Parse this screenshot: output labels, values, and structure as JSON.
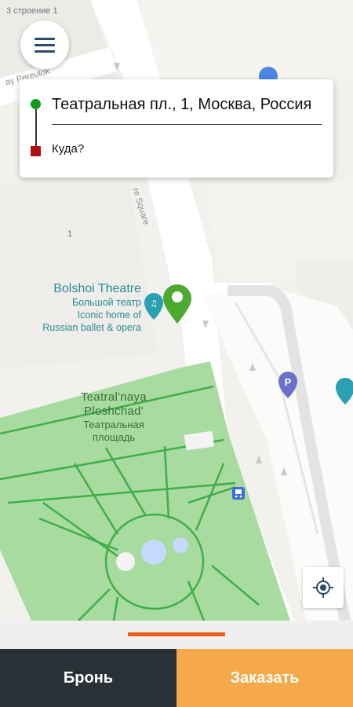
{
  "map": {
    "building_label": "3 строение 1",
    "street_top": "ay Pereulok",
    "street_square": "re Square",
    "house_number": "1",
    "poi": {
      "title": "Bolshoi Theatre",
      "subtitle_ru": "Большой театр",
      "description_line1": "Iconic home of",
      "description_line2": "Russian ballet & opera"
    },
    "park": {
      "title_line1": "Teatral'naya",
      "title_line2": "Ploshchad'",
      "ru_line1": "Театральная",
      "ru_line2": "площадь"
    },
    "parking_letter": "P",
    "park_color": "#a8dba0",
    "road_color": "#ffffff",
    "pin_color": "#4ea92f",
    "poi_color": "#2aa0b0",
    "parking_color": "#6d70c8"
  },
  "menu": {
    "icon": "hamburger-menu-icon"
  },
  "route": {
    "from": "Театральная пл., 1, Москва, Россия",
    "to_placeholder": "Куда?",
    "from_color": "#139a1a",
    "to_color": "#b0120f"
  },
  "controls": {
    "locate_icon": "my-location-icon"
  },
  "actions": {
    "book_label": "Бронь",
    "order_label": "Заказать",
    "book_color": "#2a3136",
    "order_color": "#f5a94a",
    "handle_color": "#ee5d1a"
  }
}
